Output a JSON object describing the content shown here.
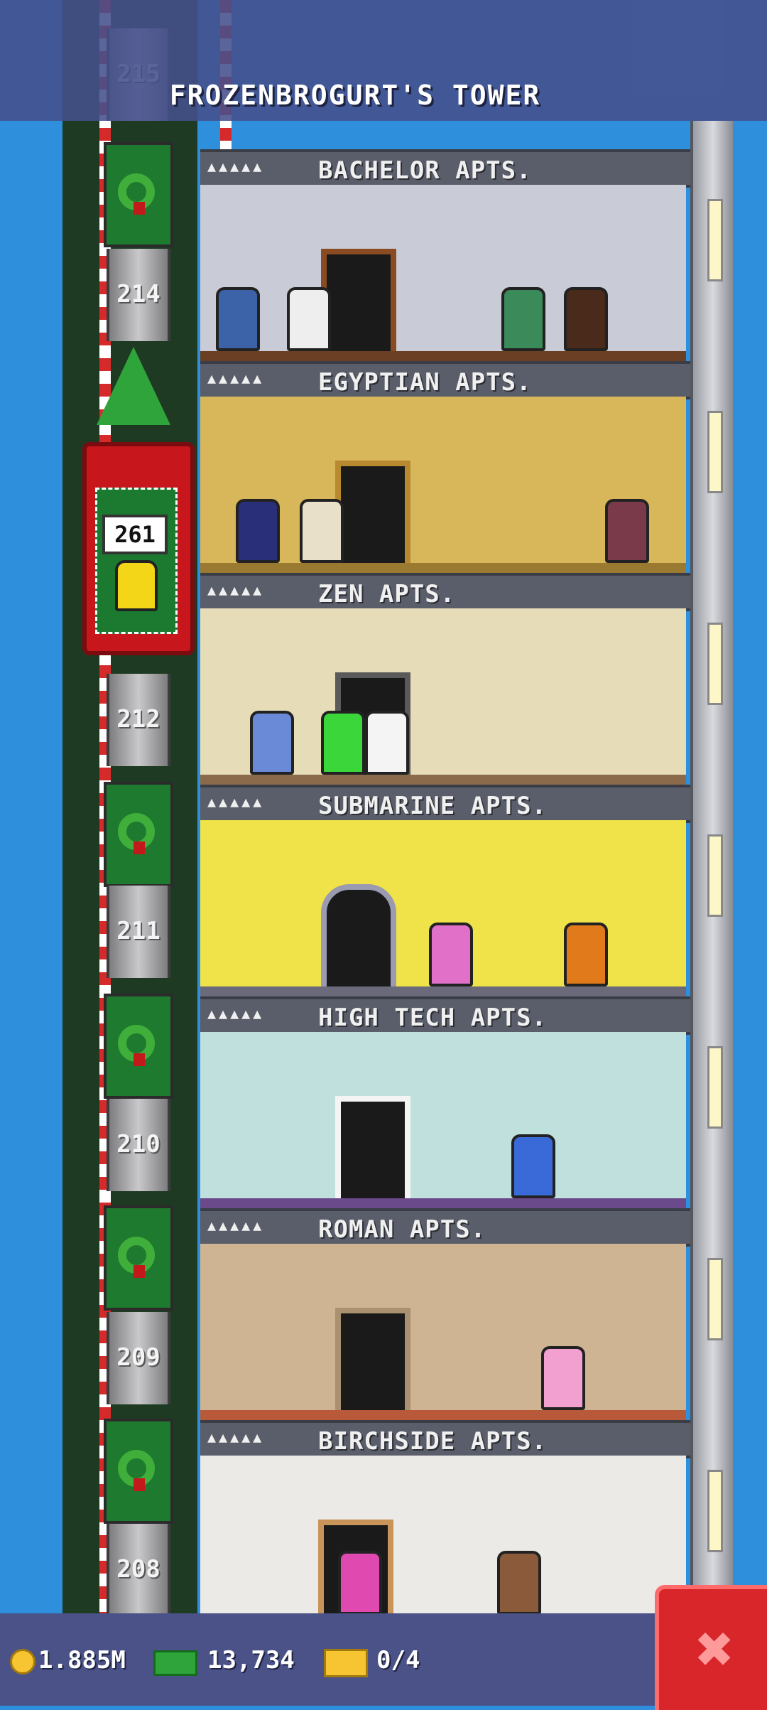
{
  "header": {
    "title": "FROZENBROGURT'S TOWER"
  },
  "shaft": {
    "floor_numbers": [
      "215",
      "214",
      "212",
      "211",
      "210",
      "209",
      "208"
    ],
    "elevator_counter": "261"
  },
  "floors": [
    {
      "name": "BACHELOR APTS.",
      "stars": "▲▲▲▲▲",
      "color": "#c9ccd6"
    },
    {
      "name": "EGYPTIAN APTS.",
      "stars": "▲▲▲▲▲",
      "color": "#d8b65a"
    },
    {
      "name": "ZEN APTS.",
      "stars": "▲▲▲▲▲",
      "color": "#e7dcb8"
    },
    {
      "name": "SUBMARINE APTS.",
      "stars": "▲▲▲▲▲",
      "color": "#f0e34a"
    },
    {
      "name": "HIGH TECH APTS.",
      "stars": "▲▲▲▲▲",
      "color": "#bfe0dc"
    },
    {
      "name": "ROMAN APTS.",
      "stars": "▲▲▲▲▲",
      "color": "#cfb493"
    },
    {
      "name": "BIRCHSIDE APTS.",
      "stars": "▲▲▲▲▲",
      "color": "#eceae6"
    }
  ],
  "status": {
    "coins": "1.885M",
    "bux": "13,734",
    "tickets": "0/4"
  },
  "icons": {
    "coins": "coin-icon",
    "bux": "bux-icon",
    "tickets": "ticket-icon",
    "close": "close-icon"
  }
}
